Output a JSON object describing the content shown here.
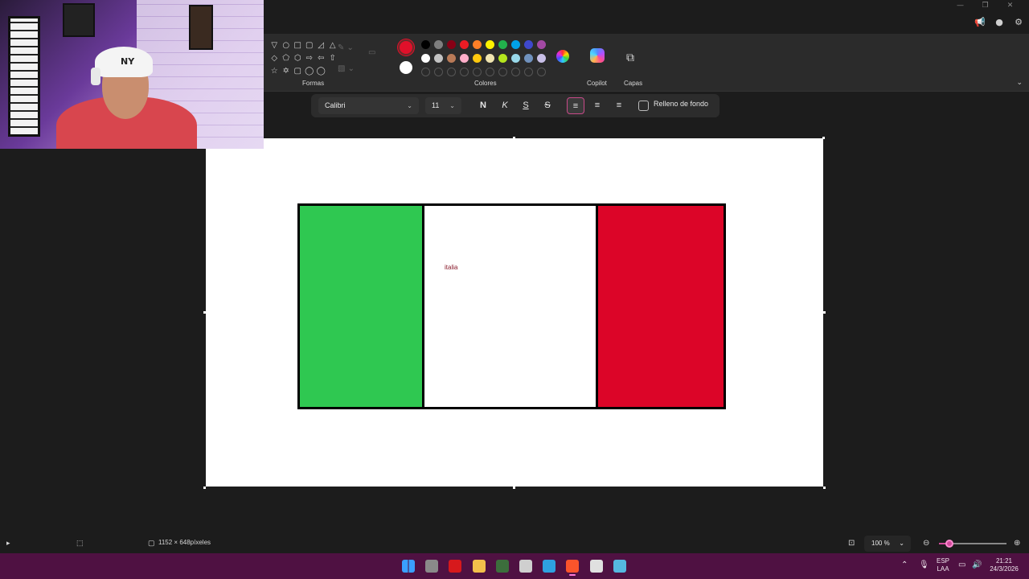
{
  "window": {
    "controls": [
      "—",
      "❐",
      "✕"
    ],
    "title_icons": [
      "megaphone-icon",
      "account-icon",
      "gear-icon"
    ]
  },
  "ribbon": {
    "groups": {
      "shapes_label": "Formas",
      "colors_label": "Colores",
      "copilot_label": "Copilot",
      "layers_label": "Capas"
    },
    "shape_glyphs": [
      "▽",
      "○",
      "□",
      "▢",
      "◿",
      "△",
      "◇",
      "⬠",
      "⬡",
      "⇨",
      "⇦",
      "⇧",
      "☆",
      "✡",
      "▢",
      "◯",
      "◯",
      "◯"
    ],
    "primary_color": "#e0102a",
    "secondary_color": "#ffffff",
    "palette_row1": [
      "#000000",
      "#7f7f7f",
      "#880015",
      "#ed1c24",
      "#ff7f27",
      "#fff200",
      "#22b14c",
      "#00a2e8",
      "#3f48cc",
      "#a349a4"
    ],
    "palette_row2": [
      "#ffffff",
      "#c3c3c3",
      "#b97a57",
      "#ffaec9",
      "#ffc90e",
      "#efe4b0",
      "#b5e61d",
      "#99d9ea",
      "#7092be",
      "#c8bfe7"
    ]
  },
  "text_toolbar": {
    "font": "Calibri",
    "size": "11",
    "bold": "N",
    "italic": "K",
    "underline": "S",
    "strikethrough": "S",
    "align_left": "≡",
    "align_center": "≡",
    "align_right": "≡",
    "fill_label": "Relleno de fondo",
    "fill_checked": false,
    "active_alignment": "left"
  },
  "canvas": {
    "flag_colors": [
      "#2fc851",
      "#ffffff",
      "#dc0528"
    ],
    "text": "italia"
  },
  "status": {
    "dimensions": "1152 × 648píxeles",
    "zoom": "100 %",
    "zoom_level_fraction": 0.15
  },
  "taskbar": {
    "language_top": "ESP",
    "language_bottom": "LAA",
    "time": "21:21",
    "date": "24/3/2026",
    "apps": [
      {
        "name": "start-icon",
        "color": "#3aa0ff"
      },
      {
        "name": "file-explorer-dark-icon",
        "color": "#8a8a8a"
      },
      {
        "name": "acrobat-icon",
        "color": "#d7191c"
      },
      {
        "name": "folder-icon",
        "color": "#f3c04b"
      },
      {
        "name": "visio-icon",
        "color": "#3c6e3c"
      },
      {
        "name": "wifi-app-icon",
        "color": "#cfcfcf"
      },
      {
        "name": "edge-icon",
        "color": "#2ea1e0"
      },
      {
        "name": "brave-icon",
        "color": "#fb542b"
      },
      {
        "name": "chrome-icon",
        "color": "#e0e0e0"
      },
      {
        "name": "paint-icon",
        "color": "#55b8e0"
      }
    ]
  }
}
